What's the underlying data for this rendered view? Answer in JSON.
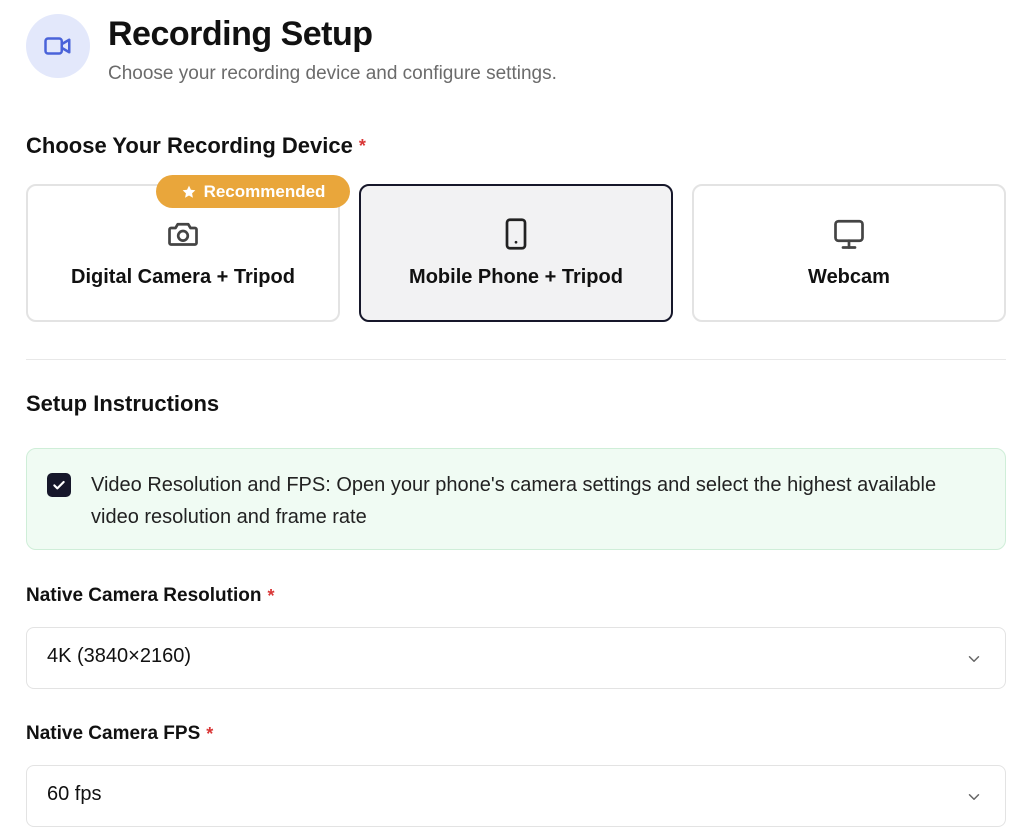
{
  "header": {
    "title": "Recording Setup",
    "subtitle": "Choose your recording device and configure settings.",
    "icon": "video-camera-icon"
  },
  "device_section": {
    "label": "Choose Your Recording Device",
    "required_mark": "*",
    "badge": "Recommended",
    "badge_icon": "star-icon",
    "options": [
      {
        "label": "Digital Camera + Tripod",
        "icon": "camera-icon",
        "selected": false,
        "recommended": true
      },
      {
        "label": "Mobile Phone + Tripod",
        "icon": "smartphone-icon",
        "selected": true,
        "recommended": false
      },
      {
        "label": "Webcam",
        "icon": "monitor-icon",
        "selected": false,
        "recommended": false
      }
    ]
  },
  "instructions": {
    "label": "Setup Instructions",
    "items": [
      {
        "text": "Video Resolution and FPS: Open your phone's camera settings and select the highest available video resolution and frame rate",
        "checked": true
      }
    ]
  },
  "resolution_field": {
    "label": "Native Camera Resolution",
    "required_mark": "*",
    "value": "4K (3840×2160)"
  },
  "fps_field": {
    "label": "Native Camera FPS",
    "required_mark": "*",
    "value": "60 fps"
  },
  "colors": {
    "accent_dark": "#16172a",
    "badge": "#e9a63b",
    "required": "#d93636",
    "instruction_bg": "#f0fbf3",
    "icon_circle_bg": "#e3e8fb"
  }
}
